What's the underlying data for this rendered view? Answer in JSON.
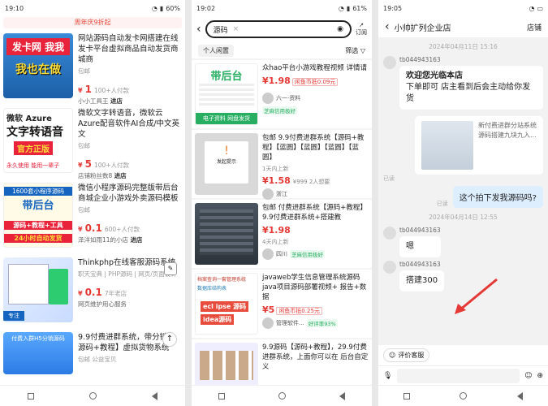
{
  "panel1": {
    "status": {
      "time": "19:10",
      "battery": "60%"
    },
    "banner": "周年庆9折起",
    "items": [
      {
        "thumb_lines": [
          "发卡网 我我",
          "我也在做"
        ],
        "title": "网站源码自动发卡网搭建在线发卡平台虚拟商品自动发货商城商",
        "shop": "包邮",
        "price": "1",
        "sales": "100+人付款",
        "store_name": "小小工具王",
        "store_link": "进店"
      },
      {
        "thumb_lines": [
          "微软 Azure",
          "文字转语音",
          "官方正版",
          "永久使用  能用一辈子"
        ],
        "title": "微软文字转语音，微软云Azure配音软件AI合成/中文英文",
        "shop": "包邮",
        "price": "5",
        "sales": "100+人付款",
        "store_name": "店铺粉丝数8",
        "store_link": "进店"
      },
      {
        "thumb_lines": [
          "1600套小程序源码",
          "带后台",
          "源码+教程+工具",
          "24小时自动发货"
        ],
        "title": "微信小程序源码完整版带后台商城企业小游戏外卖源码模板",
        "shop": "包邮",
        "price": "0.1",
        "sales": "600+人付款",
        "store_name": "泽洋如雨11的小店",
        "store_link": "进店"
      },
      {
        "thumb_lines": [
          "专注"
        ],
        "title": "Thinkphp在线客服源码系统",
        "shop": "职天宝典 | PHP源码 | 网页/页面设计",
        "price": "0.1",
        "sales": "7年老店",
        "store_name": "网页维护用心服务",
        "store_link": ""
      },
      {
        "thumb_lines": [
          "付费入群H5分销源码"
        ],
        "title": "9.9付费进群系统，带分销，源码+教程】虚拟货物系统",
        "shop": "包邮  公益宝贝",
        "price": "",
        "sales": "",
        "store_name": "",
        "store_link": ""
      }
    ]
  },
  "panel2": {
    "status": {
      "time": "19:02",
      "battery": "61%"
    },
    "search_value": "源码",
    "subscribe_label": "订阅",
    "tab_active": "个人闲置",
    "filter_label": "筛选",
    "items": [
      {
        "thumb_lines": [
          "带后台",
          "电子资料  网盘发货"
        ],
        "title": "众hao平台小游戏教程视频 详情请",
        "price": "1.98",
        "tag": "闲鱼币抵0.09元",
        "loc": "",
        "seller": "六一·资料",
        "credit": "芝麻信用极好"
      },
      {
        "thumb_lines": [
          "发起提示"
        ],
        "title": "包邮 9.9付费进群系统【源码+教程】【蓝圆】【蓝圆】【蓝圆】【蓝圆】",
        "price": "1.58",
        "tag": "¥999  2人想要",
        "loc": "1天内上新",
        "seller": "浙江",
        "credit": ""
      },
      {
        "thumb_lines": [
          ""
        ],
        "title": "包邮 付费进群系统【源码+教程】9.9付费进群系统+搭建教",
        "price": "1.98",
        "tag": "",
        "loc": "4天内上新",
        "seller": "四川",
        "credit": "芝麻信用极好"
      },
      {
        "thumb_lines": [
          "档案查询一套管理系统",
          "数据库结构表",
          "ecl ipse 源码",
          "idea源码"
        ],
        "title": "javaweb学生信息管理系统源码java项目源码部署视频+ 报告+数据",
        "price": "5",
        "tag": "闲鱼币抵0.25元",
        "loc": "",
        "seller": "管理软件...",
        "credit": "好评率93%"
      },
      {
        "thumb_lines": [
          ""
        ],
        "title": "9.9源码【源码+教程】，29.9付费进群系统，上面你可以在 后台自定义",
        "price": "",
        "tag": "",
        "loc": "",
        "seller": "",
        "credit": ""
      }
    ]
  },
  "panel3": {
    "status": {
      "time": "19:05",
      "battery": ""
    },
    "title": "小帅扩列企业店",
    "shop_label": "店铺",
    "date1": "2024年04月11日 15:16",
    "user": "tb044943163",
    "welcome_title": "欢迎您光临本店",
    "welcome_body": "下单即可 店主看到后会主动给你发货",
    "card_text": "新付费进群分站系统 源码搭建九块九入...",
    "read": "已读",
    "my_msg": "这个拍下发我源码吗?",
    "date2": "2024年04月14日 12:55",
    "reply1": "嗯",
    "reply2": "搭建300",
    "eval_btn": "评价客服"
  }
}
